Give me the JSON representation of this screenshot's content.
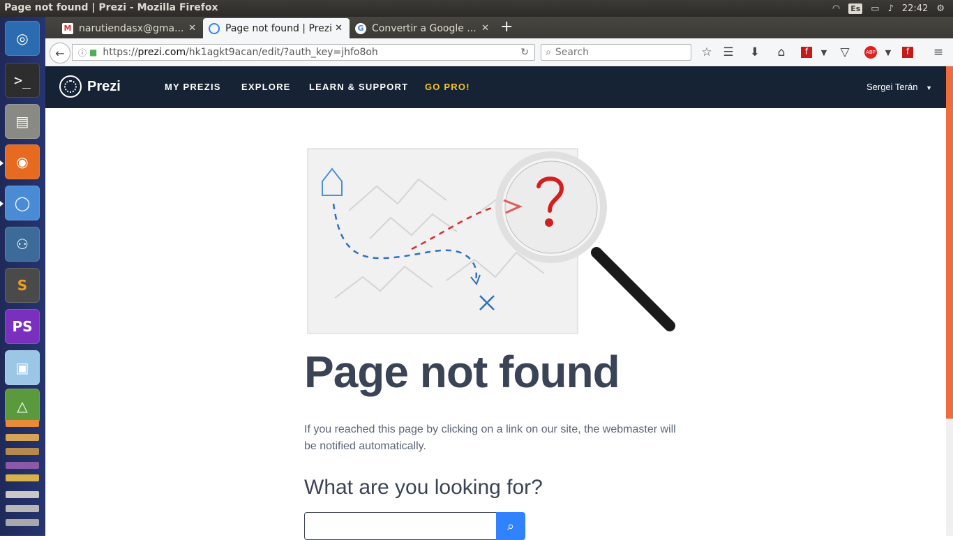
{
  "window": {
    "title": "Page not found | Prezi - Mozilla Firefox"
  },
  "tray": {
    "keyboard": "Es",
    "clock": "22:42"
  },
  "tabs": [
    {
      "label": "narutiendasx@gma...",
      "favicon": "gmail-icon"
    },
    {
      "label": "Page not found | Prezi",
      "favicon": "prezi-icon",
      "active": true
    },
    {
      "label": "Convertir a Google ...",
      "favicon": "google-icon"
    }
  ],
  "navbar": {
    "url_scheme": "https://",
    "url_domain": "prezi.com",
    "url_path": "/hk1agkt9acan/edit/?auth_key=jhfo8oh",
    "search_placeholder": "Search"
  },
  "prezi": {
    "brand": "Prezi",
    "nav": [
      "MY PREZIS",
      "EXPLORE",
      "LEARN & SUPPORT",
      "GO PRO!"
    ],
    "user": "Sergei Terán"
  },
  "content": {
    "heading": "Page not found",
    "paragraph": "If you reached this page by clicking on a link on our site, the webmaster will be notified automatically.",
    "subheading": "What are you looking for?"
  },
  "colors": {
    "header_bg": "#162335",
    "go_pro": "#f9c623",
    "search_btn": "#3082ff",
    "scroll_accent": "#f06c3c"
  }
}
